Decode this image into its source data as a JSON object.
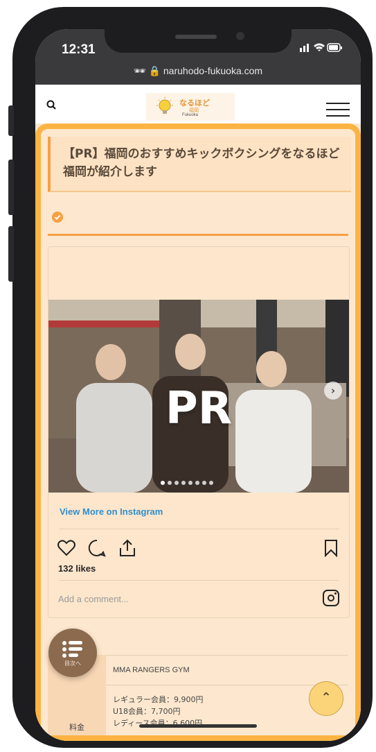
{
  "status": {
    "time": "12:31",
    "signal_icon": "signal-bars-icon",
    "wifi_icon": "wifi-icon",
    "battery_icon": "battery-icon"
  },
  "browser": {
    "url": "naruhodo-fukuoka.com"
  },
  "header": {
    "logo_text": "なるほど",
    "logo_sub": "福岡",
    "logo_sub2": "Fukuoka"
  },
  "article": {
    "title": "【PR】福岡のおすすめキックボクシングをなるほど福岡が紹介します"
  },
  "instagram": {
    "overlay_text": "PR",
    "view_more": "View More on Instagram",
    "likes": "132 likes",
    "comment_placeholder": "Add a comment...",
    "slide_count": 8,
    "active_slide": 1
  },
  "table": {
    "gym_name": "MMA RANGERS GYM",
    "fee_label": "料金",
    "prices": [
      "レギュラー会員：9,900円",
      "U18会員：7,700円",
      "レディース会員：6,600円"
    ]
  },
  "toc_button": {
    "label": "目次へ"
  },
  "colors": {
    "accent": "#fbb443",
    "bg": "#fde8cf",
    "link": "#2f8fd0"
  }
}
